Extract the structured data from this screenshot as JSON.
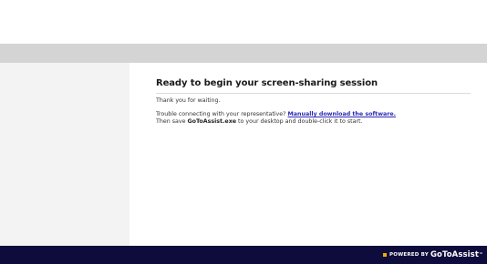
{
  "main": {
    "heading": "Ready to begin your screen-sharing session",
    "waiting_text": "Thank you for waiting.",
    "trouble_text": "Trouble connecting with your representative?",
    "download_link": "Manually download the software.",
    "save_prefix": "Then save",
    "save_filename": "GoToAssist.exe",
    "save_suffix": "to your desktop and double-click it to start."
  },
  "footer": {
    "powered_by": "POWERED BY",
    "brand": "GoToAssist",
    "trademark": "™"
  },
  "colors": {
    "band": "#d4d4d4",
    "sidebar": "#f3f3f3",
    "footer": "#0e0c3c",
    "link": "#2a2ab8",
    "bullet": "#f2a900"
  }
}
